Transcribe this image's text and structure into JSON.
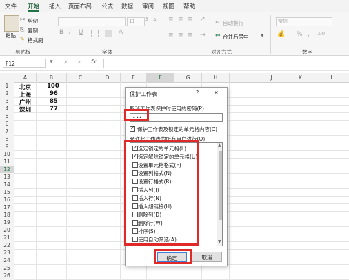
{
  "colors": {
    "accent": "#217346",
    "highlight": "#e02a2a"
  },
  "menu": [
    "文件",
    "开始",
    "插入",
    "页面布局",
    "公式",
    "数据",
    "审阅",
    "视图",
    "帮助"
  ],
  "ribbon": {
    "paste": "粘贴",
    "cut": "剪切",
    "copy": "复制",
    "format_painter": "格式刷",
    "font_name": "",
    "font_size": "11",
    "bold": "B",
    "italic": "I",
    "underline": "U",
    "wrap_text": "自动换行",
    "merge_center": "合并后居中",
    "number_format": "常规",
    "percent": "%",
    "comma": ",",
    "groups": {
      "clipboard": "剪贴板",
      "font": "字体",
      "alignment": "对齐方式",
      "number": "数字"
    }
  },
  "formula_bar": {
    "name_box": "F12",
    "cancel": "✕",
    "enter": "✓",
    "fx": "fx",
    "formula": ""
  },
  "columns": [
    "A",
    "B",
    "C",
    "D",
    "E",
    "F",
    "G",
    "H",
    "I",
    "J",
    "K",
    "L"
  ],
  "rows": [
    "1",
    "2",
    "3",
    "4",
    "5",
    "6",
    "7",
    "8",
    "9",
    "10",
    "11",
    "12",
    "13",
    "14",
    "15",
    "16",
    "17",
    "18",
    "19",
    "20",
    "21",
    "22",
    "23",
    "24",
    "25",
    "26"
  ],
  "cells": [
    {
      "label": "北京",
      "value": "100"
    },
    {
      "label": "上海",
      "value": "96"
    },
    {
      "label": "广州",
      "value": "85"
    },
    {
      "label": "深圳",
      "value": "77"
    }
  ],
  "dialog": {
    "title": "保护工作表",
    "help": "?",
    "close": "✕",
    "password_label": "取消工作表保护时使用的密码(P):",
    "password_value": "•••",
    "protect_label": "保护工作表及锁定的单元格内容(C)",
    "allow_label": "允许此工作表的所有用户进行(O):",
    "options": [
      {
        "label": "选定锁定的单元格(L)",
        "checked": true
      },
      {
        "label": "选定解除锁定的单元格(U)",
        "checked": true
      },
      {
        "label": "设置单元格格式(F)",
        "checked": false
      },
      {
        "label": "设置列格式(N)",
        "checked": false
      },
      {
        "label": "设置行格式(R)",
        "checked": false
      },
      {
        "label": "插入列(I)",
        "checked": false
      },
      {
        "label": "插入行(N)",
        "checked": false
      },
      {
        "label": "插入超链接(H)",
        "checked": false
      },
      {
        "label": "删除列(D)",
        "checked": false
      },
      {
        "label": "删除行(W)",
        "checked": false
      },
      {
        "label": "排序(S)",
        "checked": false
      },
      {
        "label": "使用自动筛选(A)",
        "checked": false
      }
    ],
    "ok": "确定",
    "cancel": "取消"
  }
}
